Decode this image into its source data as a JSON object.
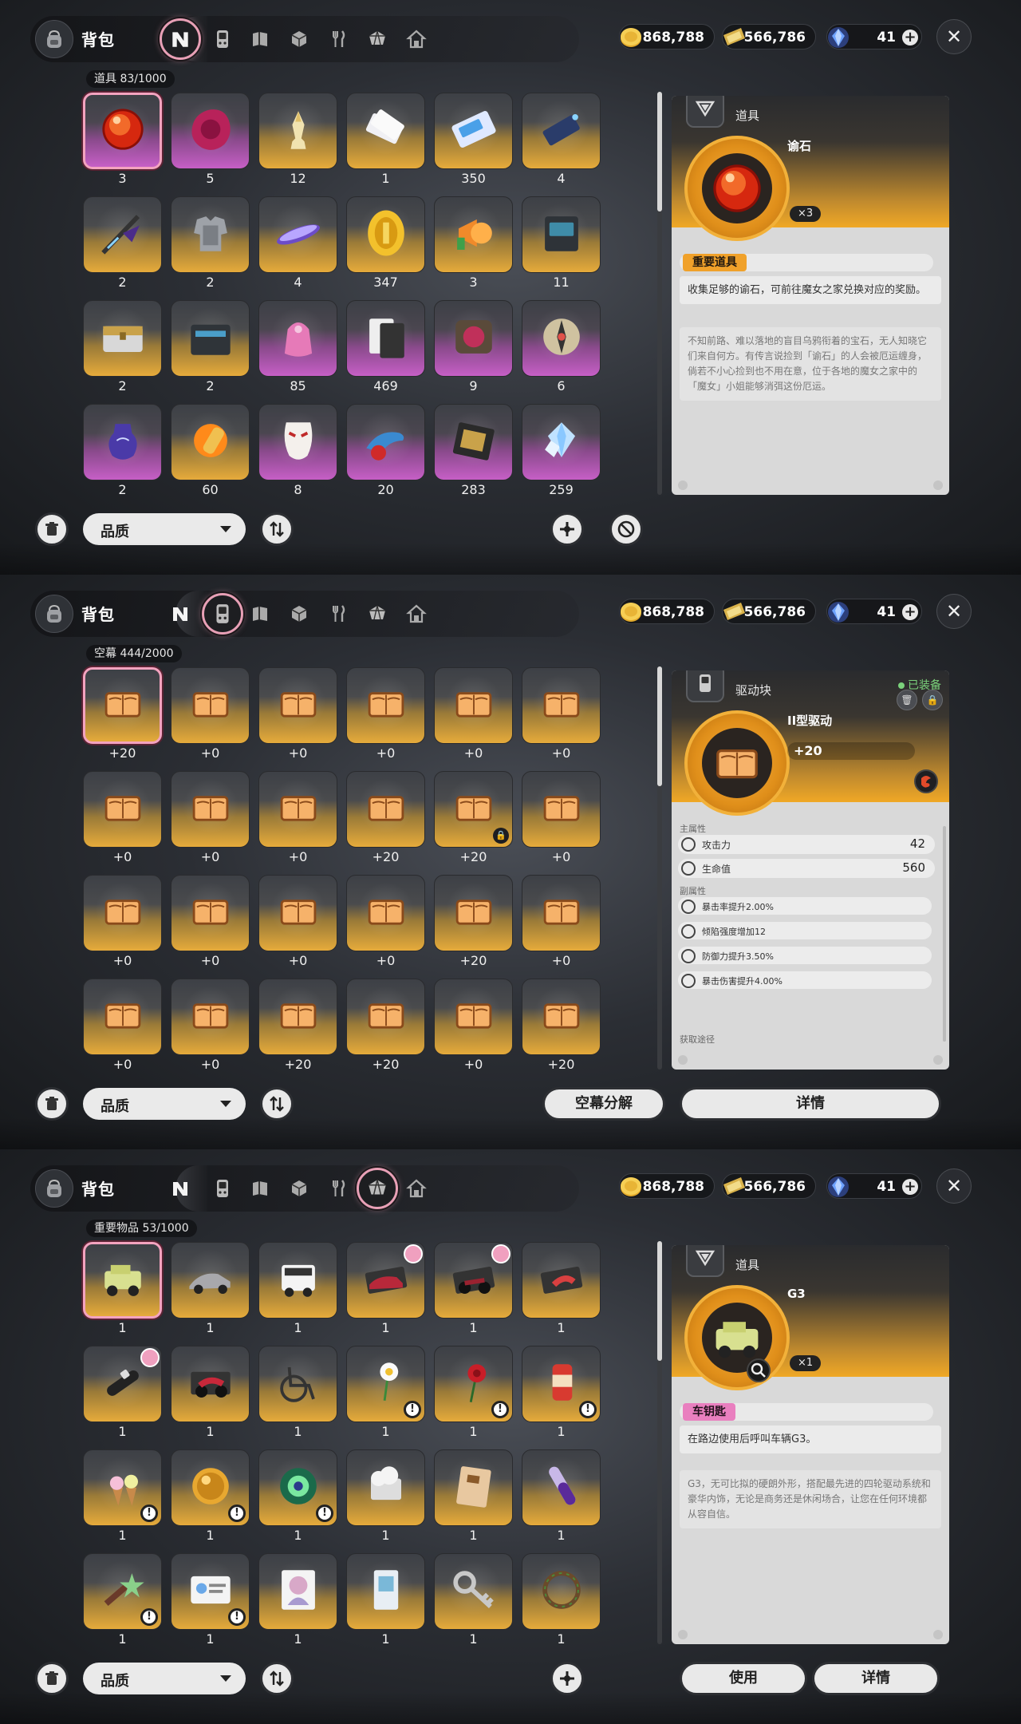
{
  "header": {
    "title": "背包",
    "currencies": [
      {
        "value": "868,788",
        "icon": "gold-coin-icon",
        "color": "#f0c040"
      },
      {
        "value": "566,786",
        "icon": "ticket-icon",
        "color": "#e9c15a"
      },
      {
        "value": "41",
        "icon": "crystal-icon",
        "color": "#4c7bd8"
      }
    ],
    "tabs": [
      "logo-n-icon",
      "handheld-device-icon",
      "book-icon",
      "cube-icon",
      "fork-knife-icon",
      "gem-box-icon",
      "house-icon"
    ]
  },
  "panels": [
    {
      "active_tab": 0,
      "grid_label": "道具  83/1000",
      "items": [
        {
          "icon": "red-orb",
          "count": "3",
          "rarity": "purple",
          "selected": true
        },
        {
          "icon": "wax-seal",
          "count": "5",
          "rarity": "purple"
        },
        {
          "icon": "chess-piece",
          "count": "12",
          "rarity": "gold"
        },
        {
          "icon": "tickets",
          "count": "1",
          "rarity": "gold"
        },
        {
          "icon": "blue-ticket",
          "count": "350",
          "rarity": "gold"
        },
        {
          "icon": "thread-spool",
          "count": "4",
          "rarity": "gold"
        },
        {
          "icon": "weapon",
          "count": "2",
          "rarity": "gold"
        },
        {
          "icon": "armor",
          "count": "2",
          "rarity": "gold"
        },
        {
          "icon": "hoverboard",
          "count": "4",
          "rarity": "gold"
        },
        {
          "icon": "gold-coin",
          "count": "347",
          "rarity": "gold"
        },
        {
          "icon": "megaphone",
          "count": "3",
          "rarity": "gold"
        },
        {
          "icon": "battery-box",
          "count": "11",
          "rarity": "gold"
        },
        {
          "icon": "chest",
          "count": "2",
          "rarity": "gold"
        },
        {
          "icon": "toolbox",
          "count": "2",
          "rarity": "gold"
        },
        {
          "icon": "gift-bag",
          "count": "85",
          "rarity": "purple"
        },
        {
          "icon": "cards",
          "count": "469",
          "rarity": "purple"
        },
        {
          "icon": "device",
          "count": "9",
          "rarity": "purple"
        },
        {
          "icon": "compass",
          "count": "6",
          "rarity": "purple"
        },
        {
          "icon": "potion",
          "count": "2",
          "rarity": "purple"
        },
        {
          "icon": "fire-shell",
          "count": "60",
          "rarity": "gold"
        },
        {
          "icon": "mask",
          "count": "8",
          "rarity": "purple"
        },
        {
          "icon": "dolphin",
          "count": "20",
          "rarity": "purple"
        },
        {
          "icon": "film-box",
          "count": "283",
          "rarity": "purple"
        },
        {
          "icon": "diamond-cluster",
          "count": "259",
          "rarity": "purple"
        }
      ],
      "quality_label": "品质",
      "detail": {
        "category": "道具",
        "name": "谕石",
        "quantity": "×3",
        "tag": "重要道具",
        "desc": "收集足够的谕石，可前往魔女之家兑换对应的奖励。",
        "lore": "不知前路、难以落地的盲目乌鸦衔着的宝石，无人知晓它们来自何方。有传言说捡到「谕石」的人会被厄运缠身，倘若不小心捡到也不用在意，位于各地的魔女之家中的「魔女」小姐能够消弭这份厄运。"
      }
    },
    {
      "active_tab": 1,
      "grid_label": "空幕  444/2000",
      "items": [
        {
          "count": "+20",
          "selected": true
        },
        {
          "count": "+0"
        },
        {
          "count": "+0"
        },
        {
          "count": "+0"
        },
        {
          "count": "+0"
        },
        {
          "count": "+0"
        },
        {
          "count": "+0"
        },
        {
          "count": "+0"
        },
        {
          "count": "+0"
        },
        {
          "count": "+20"
        },
        {
          "count": "+20",
          "locked": true
        },
        {
          "count": "+0"
        },
        {
          "count": "+0"
        },
        {
          "count": "+0"
        },
        {
          "count": "+0"
        },
        {
          "count": "+0"
        },
        {
          "count": "+20"
        },
        {
          "count": "+0"
        },
        {
          "count": "+0"
        },
        {
          "count": "+0"
        },
        {
          "count": "+20"
        },
        {
          "count": "+20"
        },
        {
          "count": "+0"
        },
        {
          "count": "+20"
        }
      ],
      "quality_label": "品质",
      "decompose_label": "空幕分解",
      "details_label": "详情",
      "detail": {
        "category": "驱动块",
        "equipped": "已装备",
        "name": "II型驱动",
        "level": "+20",
        "main_label": "主属性",
        "main_stats": [
          {
            "name": "攻击力",
            "value": "42"
          },
          {
            "name": "生命值",
            "value": "560"
          }
        ],
        "sub_label": "副属性",
        "sub_stats": [
          "暴击率提升2.00%",
          "倾陷强度增加12",
          "防御力提升3.50%",
          "暴击伤害提升4.00%"
        ],
        "source_label": "获取途径"
      }
    },
    {
      "active_tab": 5,
      "grid_label": "重要物品  53/1000",
      "items": [
        {
          "icon": "jeep",
          "count": "1",
          "selected": true
        },
        {
          "icon": "sports-car",
          "count": "1"
        },
        {
          "icon": "van",
          "count": "1"
        },
        {
          "icon": "red-car",
          "count": "1",
          "pin": true
        },
        {
          "icon": "motorbike",
          "count": "1",
          "pin": true
        },
        {
          "icon": "scooter",
          "count": "1"
        },
        {
          "icon": "car-key",
          "count": "1",
          "pin": true
        },
        {
          "icon": "red-motorbike",
          "count": "1"
        },
        {
          "icon": "wheelchair",
          "count": "1"
        },
        {
          "icon": "daisy",
          "count": "1",
          "warn": true
        },
        {
          "icon": "rose",
          "count": "1",
          "warn": true
        },
        {
          "icon": "can",
          "count": "1",
          "warn": true
        },
        {
          "icon": "ice-cream",
          "count": "1",
          "warn": true
        },
        {
          "icon": "gold-ball",
          "count": "1",
          "warn": true
        },
        {
          "icon": "green-orb",
          "count": "1",
          "warn": true
        },
        {
          "icon": "cloud-box",
          "count": "1"
        },
        {
          "icon": "notebook",
          "count": "1"
        },
        {
          "icon": "vial",
          "count": "1"
        },
        {
          "icon": "star-candy",
          "count": "1",
          "warn": true
        },
        {
          "icon": "id-card",
          "count": "1",
          "warn": true
        },
        {
          "icon": "photo",
          "count": "1"
        },
        {
          "icon": "badge",
          "count": "1"
        },
        {
          "icon": "key",
          "count": "1"
        },
        {
          "icon": "wreath",
          "count": "1"
        }
      ],
      "quality_label": "品质",
      "use_label": "使用",
      "details_label": "详情",
      "detail": {
        "category": "道具",
        "name": "G3",
        "quantity": "×1",
        "tag": "车钥匙",
        "desc": "在路边使用后呼叫车辆G3。",
        "lore": "G3，无可比拟的硬朗外形，搭配最先进的四轮驱动系统和豪华内饰，无论是商务还是休闲场合，让您在任何环境都从容自信。"
      }
    }
  ]
}
